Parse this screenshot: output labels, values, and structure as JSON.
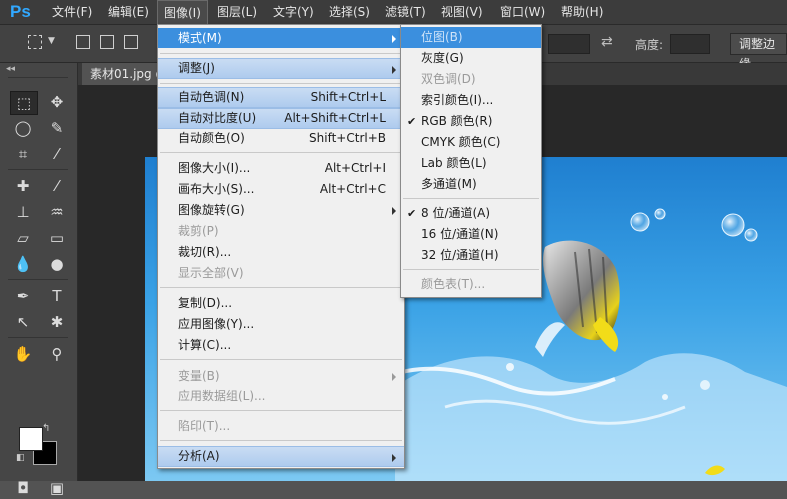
{
  "app": {
    "logo": "Ps"
  },
  "menubar": {
    "items": [
      "文件(F)",
      "编辑(E)",
      "图像(I)",
      "图层(L)",
      "文字(Y)",
      "选择(S)",
      "滤镜(T)",
      "视图(V)",
      "窗口(W)",
      "帮助(H)"
    ],
    "active": "图像(I)"
  },
  "options": {
    "height_label": "高度:",
    "refine_edge_button": "调整边缘"
  },
  "document": {
    "tab_label": "素材01.jpg @"
  },
  "image_menu": {
    "items": [
      {
        "label": "模式(M)",
        "submenu": true,
        "state": "hover"
      },
      {
        "label": "调整(J)",
        "submenu": true,
        "state": "group"
      },
      {
        "label": "自动色调(N)",
        "shortcut": "Shift+Ctrl+L",
        "state": "group"
      },
      {
        "label": "自动对比度(U)",
        "shortcut": "Alt+Shift+Ctrl+L",
        "state": "group"
      },
      {
        "label": "自动颜色(O)",
        "shortcut": "Shift+Ctrl+B"
      },
      {
        "label": "图像大小(I)...",
        "shortcut": "Alt+Ctrl+I"
      },
      {
        "label": "画布大小(S)...",
        "shortcut": "Alt+Ctrl+C"
      },
      {
        "label": "图像旋转(G)",
        "submenu": true
      },
      {
        "label": "裁剪(P)",
        "disabled": true
      },
      {
        "label": "裁切(R)..."
      },
      {
        "label": "显示全部(V)",
        "disabled": true
      },
      {
        "label": "复制(D)..."
      },
      {
        "label": "应用图像(Y)..."
      },
      {
        "label": "计算(C)..."
      },
      {
        "label": "变量(B)",
        "submenu": true,
        "disabled": true
      },
      {
        "label": "应用数据组(L)...",
        "disabled": true
      },
      {
        "label": "陷印(T)...",
        "disabled": true
      },
      {
        "label": "分析(A)",
        "submenu": true,
        "state": "group"
      }
    ]
  },
  "mode_submenu": {
    "items": [
      {
        "label": "位图(B)",
        "disabled": true,
        "state": "hover"
      },
      {
        "label": "灰度(G)"
      },
      {
        "label": "双色调(D)",
        "disabled": true
      },
      {
        "label": "索引颜色(I)..."
      },
      {
        "label": "RGB 颜色(R)",
        "checked": true
      },
      {
        "label": "CMYK 颜色(C)"
      },
      {
        "label": "Lab 颜色(L)"
      },
      {
        "label": "多通道(M)"
      },
      {
        "label": "8 位/通道(A)",
        "checked": true
      },
      {
        "label": "16 位/通道(N)"
      },
      {
        "label": "32 位/通道(H)"
      },
      {
        "label": "颜色表(T)...",
        "disabled": true
      }
    ]
  },
  "colors": {
    "accent": "#3b8fde",
    "logo": "#31a8ff",
    "foreground": "#ffffff",
    "background": "#000000"
  }
}
